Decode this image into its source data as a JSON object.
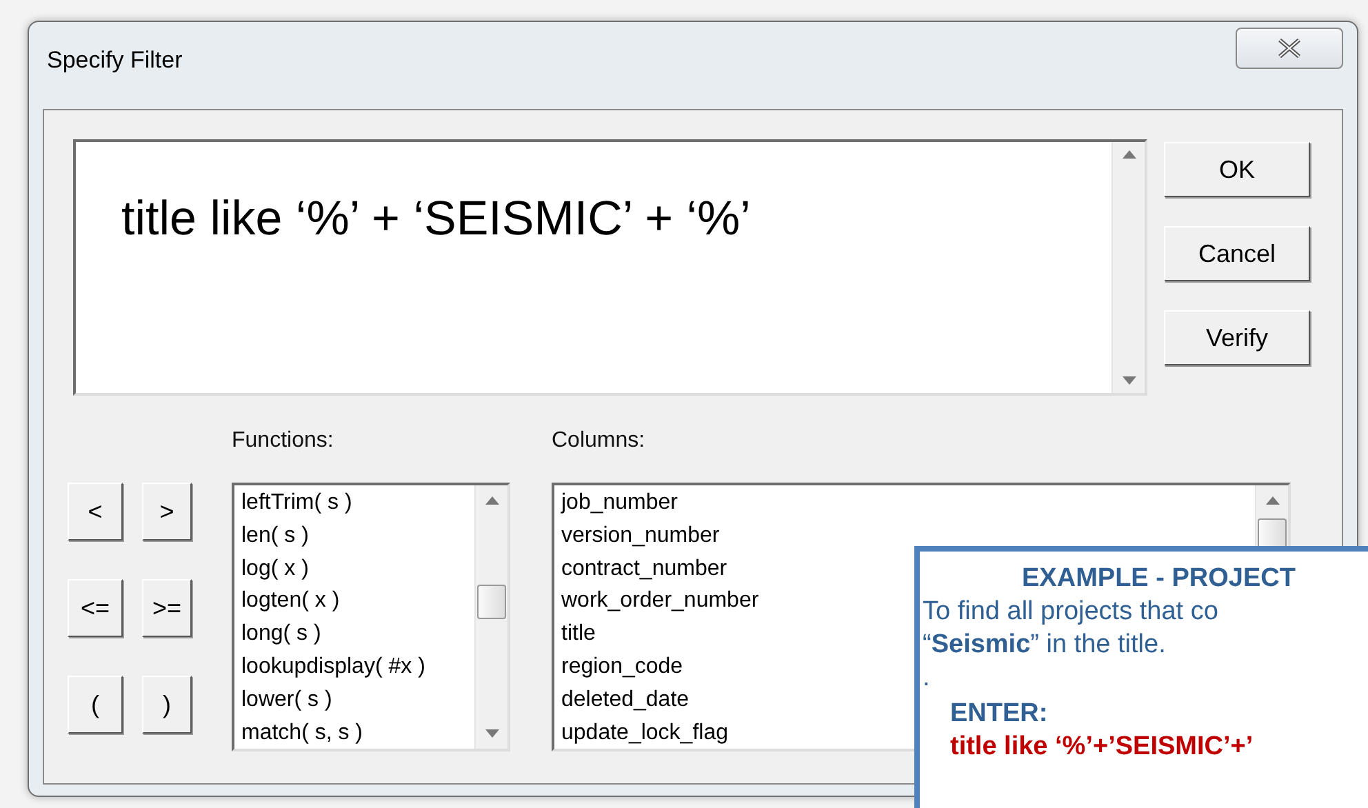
{
  "window": {
    "title": "Specify Filter"
  },
  "expression": {
    "value": "title like ‘%’ + ‘SEISMIC’ + ‘%’"
  },
  "buttons": [
    "OK",
    "Cancel",
    "Verify"
  ],
  "operators": [
    "<",
    ">",
    "<=",
    ">=",
    "(",
    ")"
  ],
  "functions": {
    "label": "Functions:",
    "items": [
      "leftTrim( s )",
      "len( s )",
      "log( x )",
      "logten( x )",
      "long( s )",
      "lookupdisplay( #x )",
      "lower( s )",
      "match( s, s )"
    ]
  },
  "columns": {
    "label": "Columns:",
    "items": [
      "job_number",
      "version_number",
      "contract_number",
      "work_order_number",
      "title",
      "region_code",
      "deleted_date",
      "update_lock_flag"
    ]
  },
  "callout": {
    "heading": "EXAMPLE - PROJECT",
    "lines": [
      "To find all projects that co",
      "“**Seismic**” in the title.",
      "."
    ],
    "enter_label": "ENTER:",
    "example": "title like ‘%’+’SEISMIC’+’"
  }
}
